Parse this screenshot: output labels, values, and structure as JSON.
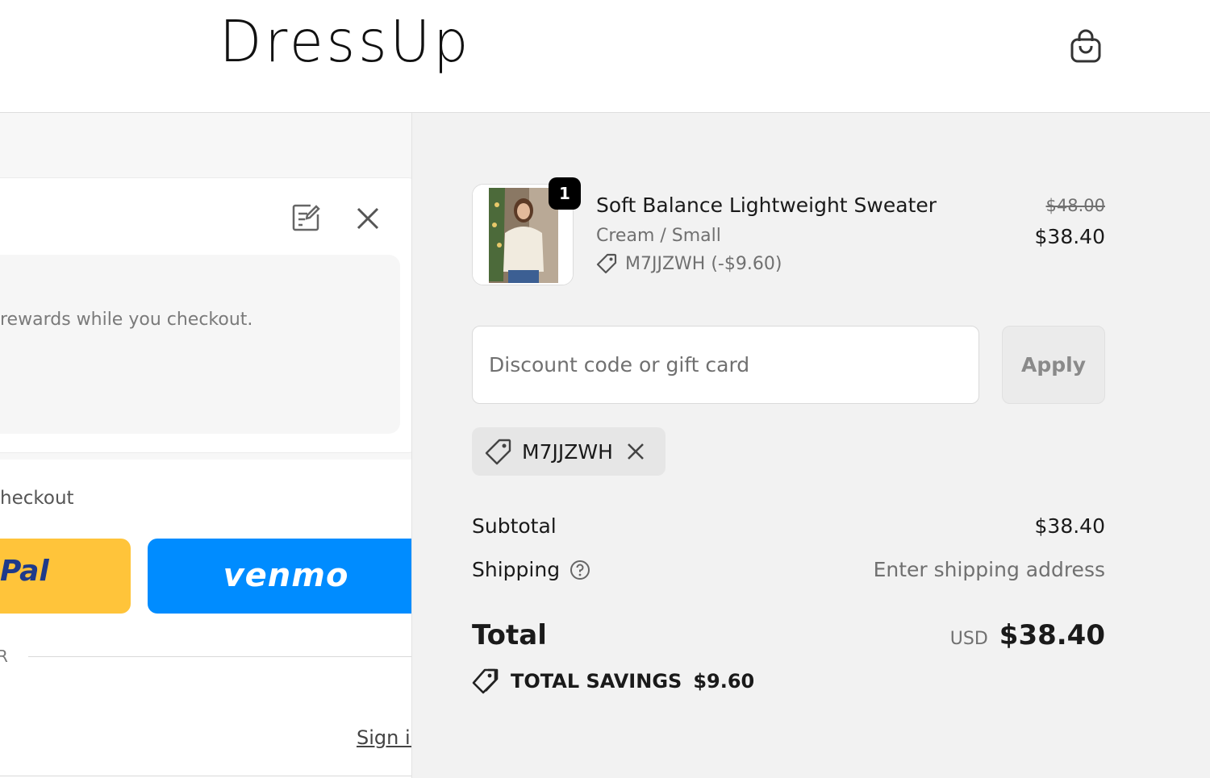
{
  "header": {
    "logo": "DressUp",
    "cart_icon": "shopping-bag-icon"
  },
  "left": {
    "rewards_text": "rewards while you checkout.",
    "express_checkout_label": "heckout",
    "paypal_label": "Pal",
    "venmo_label": "venmo",
    "or_label": "R",
    "sign_in_label": "Sign in",
    "edit_icon": "edit-icon",
    "close_icon": "close-icon"
  },
  "order": {
    "item": {
      "quantity": "1",
      "name": "Soft Balance Lightweight Sweater",
      "variant": "Cream / Small",
      "discount": "M7JJZWH (-$9.60)",
      "original_price": "$48.00",
      "price": "$38.40"
    },
    "discount_field": {
      "placeholder": "Discount code or gift card",
      "value": ""
    },
    "apply_label": "Apply",
    "applied_code": "M7JJZWH",
    "subtotal_label": "Subtotal",
    "subtotal_value": "$38.40",
    "shipping_label": "Shipping",
    "shipping_value": "Enter shipping address",
    "total_label": "Total",
    "total_currency": "USD",
    "total_value": "$38.40",
    "savings_label": "TOTAL SAVINGS",
    "savings_value": "$9.60"
  },
  "colors": {
    "paypal": "#ffc43a",
    "venmo": "#008cff",
    "summary_bg": "#f2f2f2"
  }
}
